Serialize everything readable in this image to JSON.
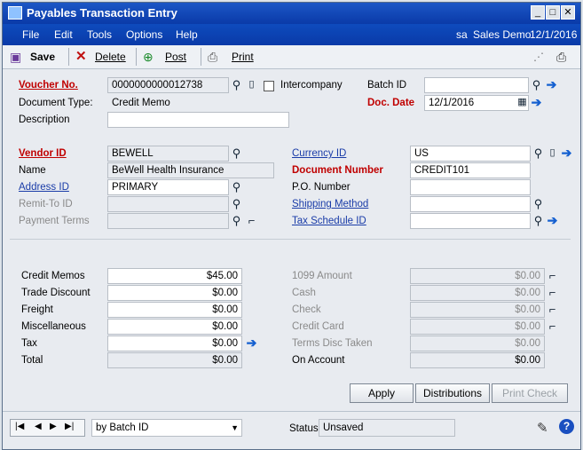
{
  "window": {
    "title": "Payables Transaction Entry",
    "min_label": "_",
    "max_label": "□",
    "close_label": "✕"
  },
  "menu": {
    "items": [
      "File",
      "Edit",
      "Tools",
      "Options",
      "Help"
    ],
    "user": "sa",
    "company": "Sales Demo",
    "date": "12/1/2016"
  },
  "toolbar": {
    "save": "Save",
    "delete": "Delete",
    "post": "Post",
    "print": "Print"
  },
  "form": {
    "voucher_no_label": "Voucher No.",
    "voucher_no": "0000000000012738",
    "intercompany_label": "Intercompany",
    "batch_id_label": "Batch ID",
    "batch_id": "",
    "document_type_label": "Document Type:",
    "document_type": "Credit Memo",
    "doc_date_label": "Doc. Date",
    "doc_date": "12/1/2016",
    "description_label": "Description",
    "description": "",
    "vendor_id_label": "Vendor ID",
    "vendor_id": "BEWELL",
    "currency_id_label": "Currency ID",
    "currency_id": "US",
    "name_label": "Name",
    "name": "BeWell Health Insurance",
    "document_number_label": "Document Number",
    "document_number": "CREDIT101",
    "address_id_label": "Address ID",
    "address_id": "PRIMARY",
    "po_number_label": "P.O. Number",
    "po_number": "",
    "remit_to_id_label": "Remit-To ID",
    "remit_to_id": "",
    "shipping_method_label": "Shipping Method",
    "shipping_method": "",
    "payment_terms_label": "Payment Terms",
    "payment_terms": "",
    "tax_schedule_id_label": "Tax Schedule ID",
    "tax_schedule_id": ""
  },
  "amounts_left": [
    {
      "label": "Credit Memos",
      "value": "$45.00"
    },
    {
      "label": "Trade Discount",
      "value": "$0.00"
    },
    {
      "label": "Freight",
      "value": "$0.00"
    },
    {
      "label": "Miscellaneous",
      "value": "$0.00"
    },
    {
      "label": "Tax",
      "value": "$0.00"
    },
    {
      "label": "Total",
      "value": "$0.00"
    }
  ],
  "amounts_right": [
    {
      "label": "1099 Amount",
      "value": "$0.00"
    },
    {
      "label": "Cash",
      "value": "$0.00"
    },
    {
      "label": "Check",
      "value": "$0.00"
    },
    {
      "label": "Credit Card",
      "value": "$0.00"
    },
    {
      "label": "Terms Disc Taken",
      "value": "$0.00"
    },
    {
      "label": "On Account",
      "value": "$0.00"
    }
  ],
  "buttons": {
    "apply": "Apply",
    "distributions": "Distributions",
    "print_check": "Print Check"
  },
  "statusbar": {
    "sort_by": "by Batch ID",
    "status_label": "Status",
    "status": "Unsaved"
  },
  "colors": {
    "title_bar": "#0a3aa8",
    "required_label": "#c00000",
    "link_label": "#1a3ca8",
    "window_bg": "#e8ebf0"
  }
}
